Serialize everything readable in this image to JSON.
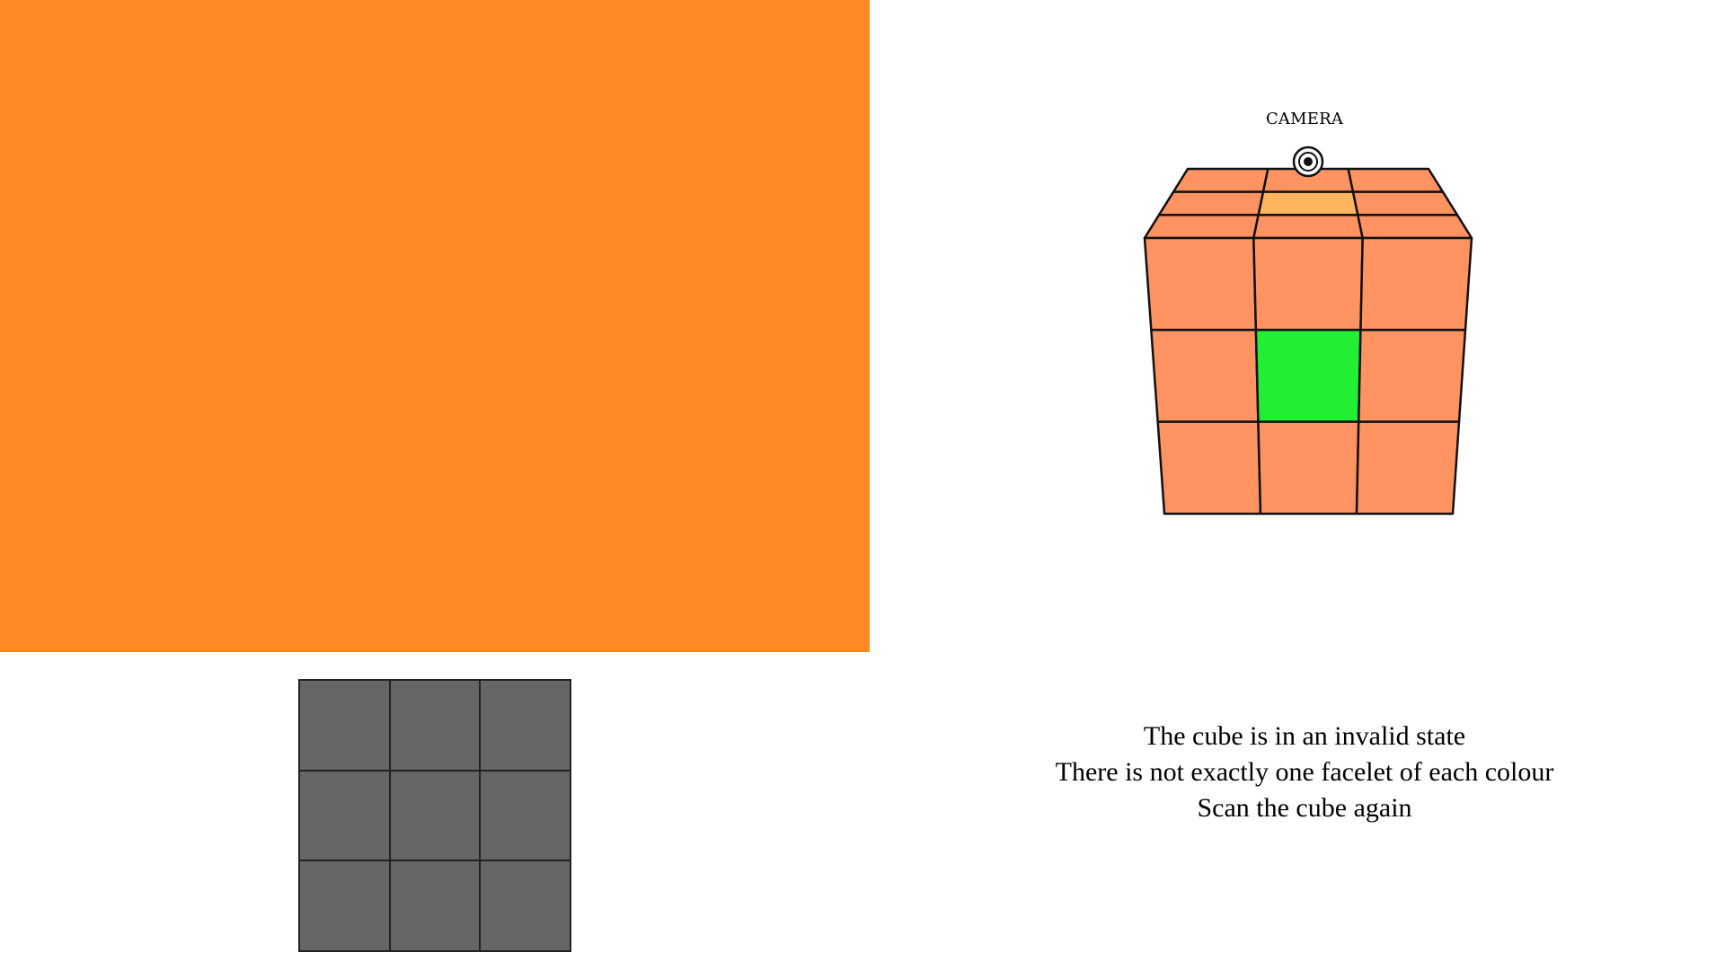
{
  "camera_feed": {
    "color": "#ff8a26"
  },
  "scan_grid": {
    "cells": [
      "#666666",
      "#666666",
      "#666666",
      "#666666",
      "#666666",
      "#666666",
      "#666666",
      "#666666",
      "#666666"
    ]
  },
  "cube_view": {
    "camera_label": "CAMERA",
    "stroke": "#111111",
    "top_face": [
      "#ff9361",
      "#ff9361",
      "#ff9361",
      "#ff9361",
      "#ffb55c",
      "#ff9361",
      "#ff9361",
      "#ff9361",
      "#ff9361"
    ],
    "front_face": [
      "#ff9361",
      "#ff9361",
      "#ff9361",
      "#ff9361",
      "#22ee33",
      "#ff9361",
      "#ff9361",
      "#ff9361",
      "#ff9361"
    ]
  },
  "message": {
    "line1": "The cube is in an invalid state",
    "line2": "There is not exactly one facelet of each colour",
    "line3": "Scan the cube again"
  }
}
